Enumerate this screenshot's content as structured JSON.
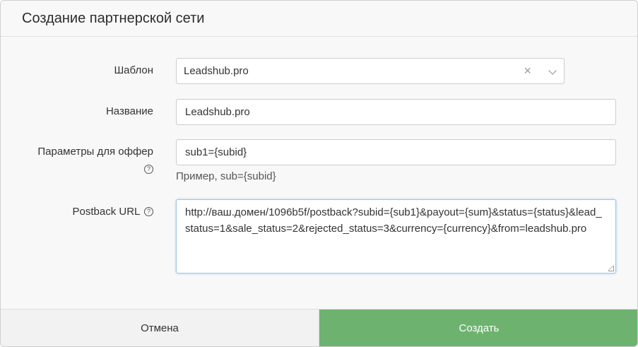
{
  "dialog": {
    "title": "Создание партнерской сети"
  },
  "form": {
    "template": {
      "label": "Шаблон",
      "value": "Leadshub.pro"
    },
    "name": {
      "label": "Название",
      "value": "Leadshub.pro"
    },
    "offer_params": {
      "label": "Параметры для оффер",
      "value": "sub1={subid}",
      "hint": "Пример, sub={subid}"
    },
    "postback": {
      "label": "Postback URL",
      "value": "http://ваш.домен/1096b5f/postback?subid={sub1}&payout={sum}&status={status}&lead_status=1&sale_status=2&rejected_status=3&currency={currency}&from=leadshub.pro"
    }
  },
  "footer": {
    "cancel_label": "Отмена",
    "create_label": "Создать"
  },
  "colors": {
    "create_button": "#6db36f",
    "cancel_button": "#f2f2f2"
  }
}
